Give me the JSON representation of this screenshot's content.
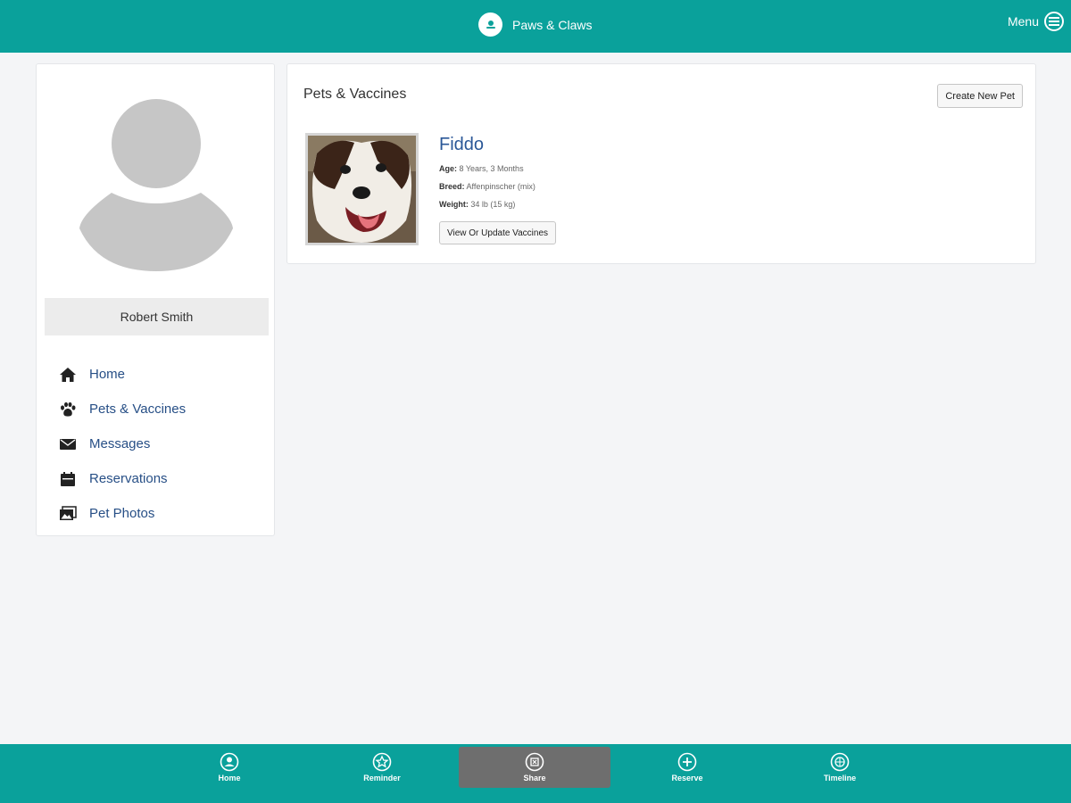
{
  "header": {
    "app_title": "Paws & Claws",
    "menu_label": "Menu",
    "logo_icon": "paw-logo-icon",
    "menu_icon": "hamburger-circle-icon"
  },
  "profile": {
    "name": "Robert Smith",
    "avatar_icon": "user-silhouette-icon"
  },
  "sidebar": {
    "items": [
      {
        "label": "Home",
        "icon": "home-icon"
      },
      {
        "label": "Pets & Vaccines",
        "icon": "paw-icon"
      },
      {
        "label": "Messages",
        "icon": "envelope-icon"
      },
      {
        "label": "Reservations",
        "icon": "calendar-icon"
      },
      {
        "label": "Pet Photos",
        "icon": "photos-icon"
      }
    ]
  },
  "main": {
    "title": "Pets & Vaccines",
    "create_button": "Create New Pet",
    "pet": {
      "name": "Fiddo",
      "age_label": "Age:",
      "age_value": "8 Years, 3 Months",
      "breed_label": "Breed:",
      "breed_value": "Affenpinscher (mix)",
      "weight_label": "Weight:",
      "weight_value": "34 lb (15 kg)",
      "vaccines_button": "View Or Update Vaccines"
    }
  },
  "tabbar": {
    "tabs": [
      {
        "label": "Home",
        "icon": "person-circle-icon",
        "active": false
      },
      {
        "label": "Reminder",
        "icon": "star-circle-icon",
        "active": false
      },
      {
        "label": "Share",
        "icon": "share-circle-icon",
        "active": true
      },
      {
        "label": "Reserve",
        "icon": "plus-circle-icon",
        "active": false
      },
      {
        "label": "Timeline",
        "icon": "timeline-circle-icon",
        "active": false
      }
    ]
  },
  "colors": {
    "brand": "#0aa19b",
    "link": "#274f86",
    "pet_name": "#2a5797",
    "active_tab": "#6e6e6e"
  }
}
